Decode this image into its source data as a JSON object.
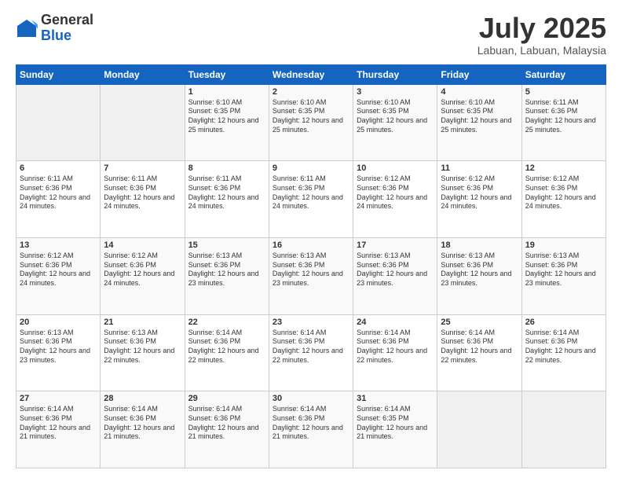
{
  "logo": {
    "general": "General",
    "blue": "Blue"
  },
  "title": "July 2025",
  "location": "Labuan, Labuan, Malaysia",
  "days_header": [
    "Sunday",
    "Monday",
    "Tuesday",
    "Wednesday",
    "Thursday",
    "Friday",
    "Saturday"
  ],
  "weeks": [
    [
      {
        "day": "",
        "empty": true
      },
      {
        "day": "",
        "empty": true
      },
      {
        "day": "1",
        "sunrise": "Sunrise: 6:10 AM",
        "sunset": "Sunset: 6:35 PM",
        "daylight": "Daylight: 12 hours and 25 minutes."
      },
      {
        "day": "2",
        "sunrise": "Sunrise: 6:10 AM",
        "sunset": "Sunset: 6:35 PM",
        "daylight": "Daylight: 12 hours and 25 minutes."
      },
      {
        "day": "3",
        "sunrise": "Sunrise: 6:10 AM",
        "sunset": "Sunset: 6:35 PM",
        "daylight": "Daylight: 12 hours and 25 minutes."
      },
      {
        "day": "4",
        "sunrise": "Sunrise: 6:10 AM",
        "sunset": "Sunset: 6:35 PM",
        "daylight": "Daylight: 12 hours and 25 minutes."
      },
      {
        "day": "5",
        "sunrise": "Sunrise: 6:11 AM",
        "sunset": "Sunset: 6:36 PM",
        "daylight": "Daylight: 12 hours and 25 minutes."
      }
    ],
    [
      {
        "day": "6",
        "sunrise": "Sunrise: 6:11 AM",
        "sunset": "Sunset: 6:36 PM",
        "daylight": "Daylight: 12 hours and 24 minutes."
      },
      {
        "day": "7",
        "sunrise": "Sunrise: 6:11 AM",
        "sunset": "Sunset: 6:36 PM",
        "daylight": "Daylight: 12 hours and 24 minutes."
      },
      {
        "day": "8",
        "sunrise": "Sunrise: 6:11 AM",
        "sunset": "Sunset: 6:36 PM",
        "daylight": "Daylight: 12 hours and 24 minutes."
      },
      {
        "day": "9",
        "sunrise": "Sunrise: 6:11 AM",
        "sunset": "Sunset: 6:36 PM",
        "daylight": "Daylight: 12 hours and 24 minutes."
      },
      {
        "day": "10",
        "sunrise": "Sunrise: 6:12 AM",
        "sunset": "Sunset: 6:36 PM",
        "daylight": "Daylight: 12 hours and 24 minutes."
      },
      {
        "day": "11",
        "sunrise": "Sunrise: 6:12 AM",
        "sunset": "Sunset: 6:36 PM",
        "daylight": "Daylight: 12 hours and 24 minutes."
      },
      {
        "day": "12",
        "sunrise": "Sunrise: 6:12 AM",
        "sunset": "Sunset: 6:36 PM",
        "daylight": "Daylight: 12 hours and 24 minutes."
      }
    ],
    [
      {
        "day": "13",
        "sunrise": "Sunrise: 6:12 AM",
        "sunset": "Sunset: 6:36 PM",
        "daylight": "Daylight: 12 hours and 24 minutes."
      },
      {
        "day": "14",
        "sunrise": "Sunrise: 6:12 AM",
        "sunset": "Sunset: 6:36 PM",
        "daylight": "Daylight: 12 hours and 24 minutes."
      },
      {
        "day": "15",
        "sunrise": "Sunrise: 6:13 AM",
        "sunset": "Sunset: 6:36 PM",
        "daylight": "Daylight: 12 hours and 23 minutes."
      },
      {
        "day": "16",
        "sunrise": "Sunrise: 6:13 AM",
        "sunset": "Sunset: 6:36 PM",
        "daylight": "Daylight: 12 hours and 23 minutes."
      },
      {
        "day": "17",
        "sunrise": "Sunrise: 6:13 AM",
        "sunset": "Sunset: 6:36 PM",
        "daylight": "Daylight: 12 hours and 23 minutes."
      },
      {
        "day": "18",
        "sunrise": "Sunrise: 6:13 AM",
        "sunset": "Sunset: 6:36 PM",
        "daylight": "Daylight: 12 hours and 23 minutes."
      },
      {
        "day": "19",
        "sunrise": "Sunrise: 6:13 AM",
        "sunset": "Sunset: 6:36 PM",
        "daylight": "Daylight: 12 hours and 23 minutes."
      }
    ],
    [
      {
        "day": "20",
        "sunrise": "Sunrise: 6:13 AM",
        "sunset": "Sunset: 6:36 PM",
        "daylight": "Daylight: 12 hours and 23 minutes."
      },
      {
        "day": "21",
        "sunrise": "Sunrise: 6:13 AM",
        "sunset": "Sunset: 6:36 PM",
        "daylight": "Daylight: 12 hours and 22 minutes."
      },
      {
        "day": "22",
        "sunrise": "Sunrise: 6:14 AM",
        "sunset": "Sunset: 6:36 PM",
        "daylight": "Daylight: 12 hours and 22 minutes."
      },
      {
        "day": "23",
        "sunrise": "Sunrise: 6:14 AM",
        "sunset": "Sunset: 6:36 PM",
        "daylight": "Daylight: 12 hours and 22 minutes."
      },
      {
        "day": "24",
        "sunrise": "Sunrise: 6:14 AM",
        "sunset": "Sunset: 6:36 PM",
        "daylight": "Daylight: 12 hours and 22 minutes."
      },
      {
        "day": "25",
        "sunrise": "Sunrise: 6:14 AM",
        "sunset": "Sunset: 6:36 PM",
        "daylight": "Daylight: 12 hours and 22 minutes."
      },
      {
        "day": "26",
        "sunrise": "Sunrise: 6:14 AM",
        "sunset": "Sunset: 6:36 PM",
        "daylight": "Daylight: 12 hours and 22 minutes."
      }
    ],
    [
      {
        "day": "27",
        "sunrise": "Sunrise: 6:14 AM",
        "sunset": "Sunset: 6:36 PM",
        "daylight": "Daylight: 12 hours and 21 minutes."
      },
      {
        "day": "28",
        "sunrise": "Sunrise: 6:14 AM",
        "sunset": "Sunset: 6:36 PM",
        "daylight": "Daylight: 12 hours and 21 minutes."
      },
      {
        "day": "29",
        "sunrise": "Sunrise: 6:14 AM",
        "sunset": "Sunset: 6:36 PM",
        "daylight": "Daylight: 12 hours and 21 minutes."
      },
      {
        "day": "30",
        "sunrise": "Sunrise: 6:14 AM",
        "sunset": "Sunset: 6:36 PM",
        "daylight": "Daylight: 12 hours and 21 minutes."
      },
      {
        "day": "31",
        "sunrise": "Sunrise: 6:14 AM",
        "sunset": "Sunset: 6:35 PM",
        "daylight": "Daylight: 12 hours and 21 minutes."
      },
      {
        "day": "",
        "empty": true
      },
      {
        "day": "",
        "empty": true
      }
    ]
  ]
}
